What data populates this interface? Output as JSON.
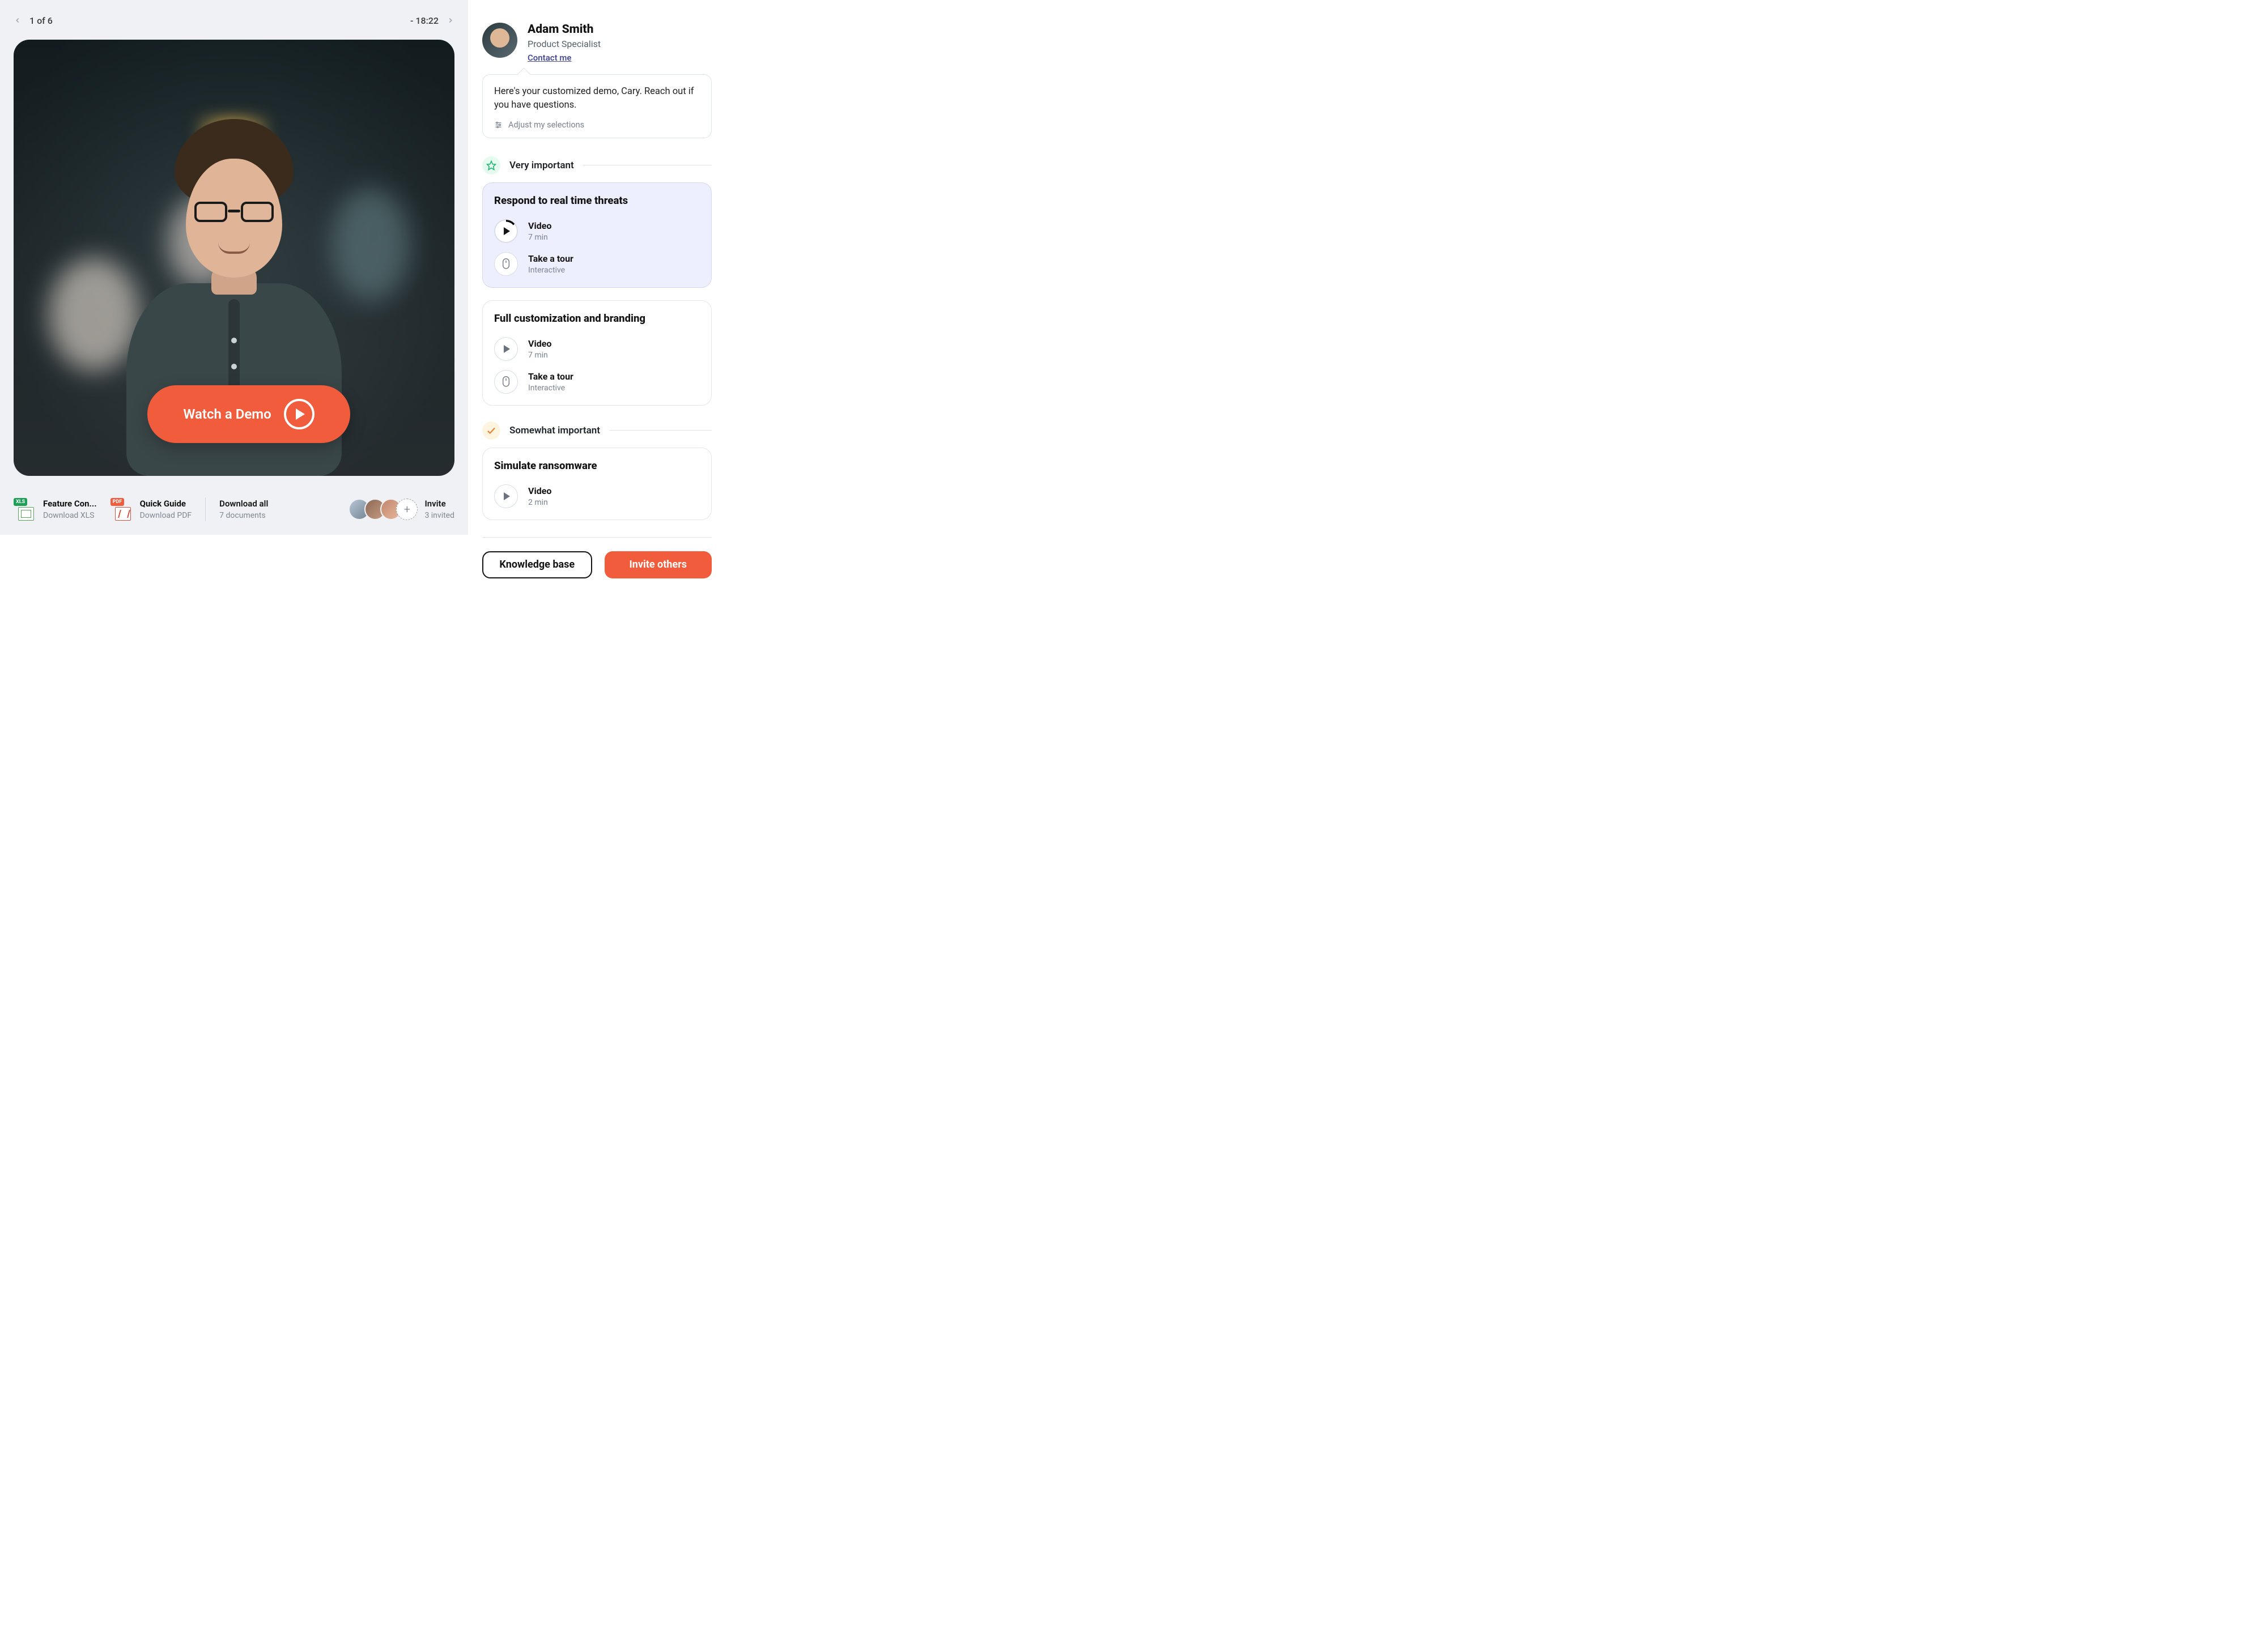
{
  "left": {
    "pager": "1 of 6",
    "timeRemaining": "- 18:22",
    "watchDemo": "Watch a Demo",
    "docs": {
      "xls": {
        "badge": "XLS",
        "title": "Feature Con...",
        "sub": "Download XLS"
      },
      "pdf": {
        "badge": "PDF",
        "title": "Quick Guide",
        "sub": "Download PDF"
      },
      "all": {
        "title": "Download all",
        "sub": "7 documents"
      }
    },
    "invite": {
      "title": "Invite",
      "sub": "3 invited"
    }
  },
  "right": {
    "specialist": {
      "name": "Adam Smith",
      "role": "Product Specialist",
      "contact": "Contact me"
    },
    "bubble": {
      "message": "Here's your customized demo, Cary. Reach out if you have questions.",
      "adjust": "Adjust my selections"
    },
    "sections": {
      "veryImportant": "Very important",
      "somewhatImportant": "Somewhat important"
    },
    "cards": {
      "threats": {
        "title": "Respond to real time threats",
        "video": {
          "label": "Video",
          "duration": "7 min"
        },
        "tour": {
          "label": "Take a tour",
          "sub": "Interactive"
        }
      },
      "custom": {
        "title": "Full customization and branding",
        "video": {
          "label": "Video",
          "duration": "7 min"
        },
        "tour": {
          "label": "Take a tour",
          "sub": "Interactive"
        }
      },
      "ransomware": {
        "title": "Simulate ransomware",
        "video": {
          "label": "Video",
          "duration": "2 min"
        }
      }
    },
    "actions": {
      "kb": "Knowledge base",
      "invite": "Invite others"
    }
  }
}
